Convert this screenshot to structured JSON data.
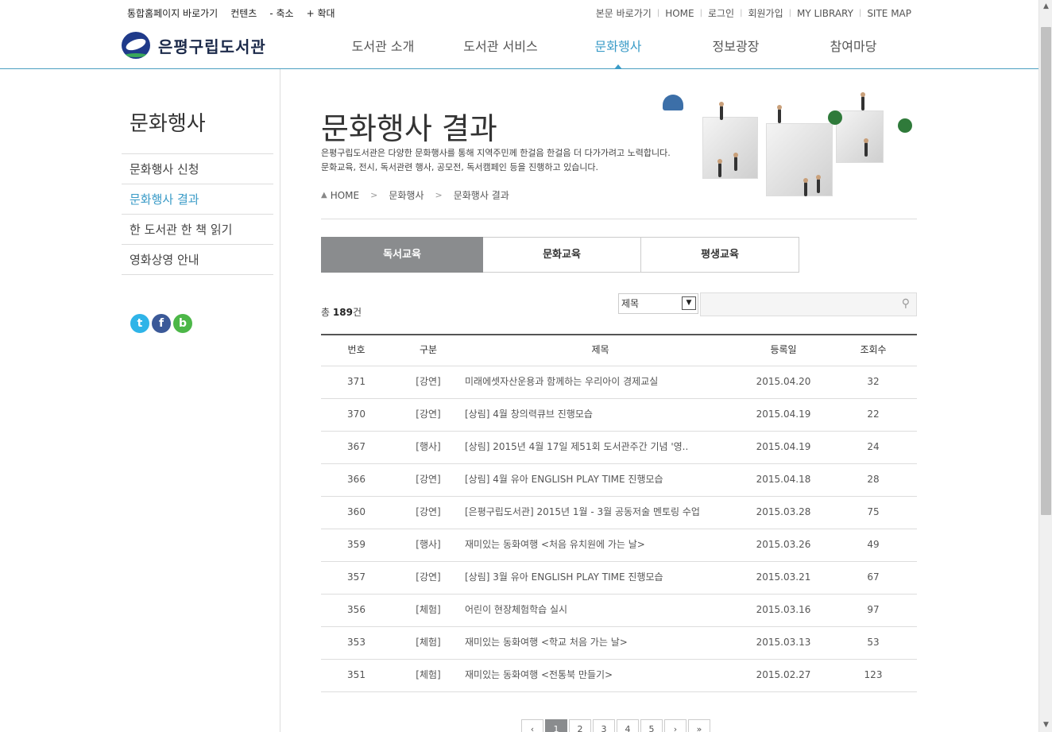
{
  "util_left": [
    "통합홈페이지 바로가기",
    "컨텐츠",
    "- 축소",
    "+ 확대"
  ],
  "util_right": [
    "본문 바로가기",
    "HOME",
    "로그인",
    "회원가입",
    "MY LIBRARY",
    "SITE MAP"
  ],
  "logo_text": "은평구립도서관",
  "gnb": [
    "도서관 소개",
    "도서관 서비스",
    "문화행사",
    "정보광장",
    "참여마당"
  ],
  "gnb_active_index": 2,
  "lnb": {
    "title": "문화행사",
    "items": [
      "문화행사 신청",
      "문화행사 결과",
      "한 도서관 한 책 읽기",
      "영화상영 안내"
    ],
    "active_index": 1,
    "social_icons": [
      "twitter-icon",
      "facebook-icon",
      "blog-icon"
    ]
  },
  "content": {
    "title": "문화행사 결과",
    "desc_line1": "은평구립도서관은 다양한 문화행사를 통해 지역주민께 한걸음 한걸음 더 다가가려고 노력합니다.",
    "desc_line2": "문화교육, 전시, 독서관련 행사, 공모전, 독서캠페인 등을 진행하고 있습니다.",
    "breadcrumb": [
      "HOME",
      "문화행사",
      "문화행사 결과"
    ],
    "tabs": [
      "독서교육",
      "문화교육",
      "평생교육"
    ],
    "active_tab": 0,
    "total_prefix": "총",
    "total_count": "189",
    "total_suffix": "건",
    "search_select": "제목",
    "search_value": ""
  },
  "board": {
    "headers": [
      "번호",
      "구분",
      "제목",
      "등록일",
      "조회수"
    ],
    "rows": [
      {
        "no": "371",
        "cat": "[강연]",
        "title": "미래에셋자산운용과 함께하는 우리아이 경제교실",
        "date": "2015.04.20",
        "views": "32"
      },
      {
        "no": "370",
        "cat": "[강연]",
        "title": "[상림] 4월 창의력큐브 진행모습",
        "date": "2015.04.19",
        "views": "22"
      },
      {
        "no": "367",
        "cat": "[행사]",
        "title": "[상림] 2015년 4월 17일 제51회 도서관주간 기념 '영..",
        "date": "2015.04.19",
        "views": "24"
      },
      {
        "no": "366",
        "cat": "[강연]",
        "title": "[상림] 4월 유아 ENGLISH PLAY TIME 진행모습",
        "date": "2015.04.18",
        "views": "28"
      },
      {
        "no": "360",
        "cat": "[강연]",
        "title": "[은평구립도서관] 2015년 1월 - 3월 공동저술 멘토링 수업",
        "date": "2015.03.28",
        "views": "75"
      },
      {
        "no": "359",
        "cat": "[행사]",
        "title": "재미있는 동화여행 <처음 유치원에 가는 날>",
        "date": "2015.03.26",
        "views": "49"
      },
      {
        "no": "357",
        "cat": "[강연]",
        "title": "[상림] 3월 유아 ENGLISH PLAY TIME 진행모습",
        "date": "2015.03.21",
        "views": "67"
      },
      {
        "no": "356",
        "cat": "[체험]",
        "title": "어린이 현장체험학습 실시",
        "date": "2015.03.16",
        "views": "97"
      },
      {
        "no": "353",
        "cat": "[체험]",
        "title": "재미있는 동화여행 <학교 처음 가는 날>",
        "date": "2015.03.13",
        "views": "53"
      },
      {
        "no": "351",
        "cat": "[체험]",
        "title": "재미있는 동화여행 <전통북 만들기>",
        "date": "2015.02.27",
        "views": "123"
      }
    ]
  },
  "paging": [
    "‹",
    "1",
    "2",
    "3",
    "4",
    "5",
    "›",
    "»"
  ],
  "paging_active": "1",
  "colors": {
    "accent": "#3a9bc7",
    "tab_active": "#8a8c8e"
  }
}
